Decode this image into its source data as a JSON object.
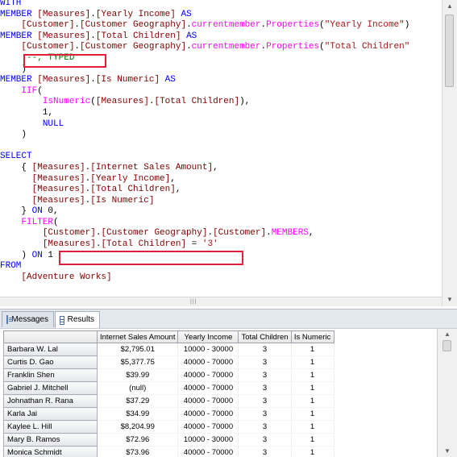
{
  "editor": {
    "lines": [
      [
        [
          "kw",
          "WITH"
        ]
      ],
      [
        [
          "kw",
          "MEMBER "
        ],
        [
          "mem",
          "[Measures]"
        ],
        [
          "",
          "."
        ],
        [
          "mem",
          "[Yearly Income]"
        ],
        [
          "kw",
          " AS"
        ]
      ],
      [
        [
          "",
          "    "
        ],
        [
          "mem",
          "[Customer]"
        ],
        [
          "",
          "."
        ],
        [
          "mem",
          "[Customer Geography]"
        ],
        [
          "",
          "."
        ],
        [
          "fn",
          "currentmember"
        ],
        [
          "",
          "."
        ],
        [
          "fn",
          "Properties"
        ],
        [
          "",
          "("
        ],
        [
          "str",
          "\"Yearly Income\""
        ],
        [
          "",
          ")"
        ]
      ],
      [
        [
          "kw",
          "MEMBER "
        ],
        [
          "mem",
          "[Measures]"
        ],
        [
          "",
          "."
        ],
        [
          "mem",
          "[Total Children]"
        ],
        [
          "kw",
          " AS"
        ]
      ],
      [
        [
          "",
          "    "
        ],
        [
          "mem",
          "[Customer]"
        ],
        [
          "",
          "."
        ],
        [
          "mem",
          "[Customer Geography]"
        ],
        [
          "",
          "."
        ],
        [
          "fn",
          "currentmember"
        ],
        [
          "",
          "."
        ],
        [
          "fn",
          "Properties"
        ],
        [
          "",
          "("
        ],
        [
          "str",
          "\"Total Children\""
        ]
      ],
      [
        [
          "",
          "     "
        ],
        [
          "cm",
          "--, TYPED"
        ]
      ],
      [
        [
          "",
          "    )"
        ]
      ],
      [
        [
          "kw",
          "MEMBER "
        ],
        [
          "mem",
          "[Measures]"
        ],
        [
          "",
          "."
        ],
        [
          "mem",
          "[Is Numeric]"
        ],
        [
          "kw",
          " AS"
        ]
      ],
      [
        [
          "",
          "    "
        ],
        [
          "fn",
          "IIF"
        ],
        [
          "",
          "("
        ]
      ],
      [
        [
          "",
          "        "
        ],
        [
          "fn",
          "IsNumeric"
        ],
        [
          "",
          "("
        ],
        [
          "mem",
          "[Measures]"
        ],
        [
          "",
          "."
        ],
        [
          "mem",
          "[Total Children]"
        ],
        [
          "",
          "),"
        ]
      ],
      [
        [
          "",
          "        1,"
        ]
      ],
      [
        [
          "",
          "        "
        ],
        [
          "kw",
          "NULL"
        ]
      ],
      [
        [
          "",
          "    )"
        ]
      ],
      [
        [
          "",
          ""
        ]
      ],
      [
        [
          "kw",
          "SELECT"
        ]
      ],
      [
        [
          "",
          "    { "
        ],
        [
          "mem",
          "[Measures]"
        ],
        [
          "",
          "."
        ],
        [
          "mem",
          "[Internet Sales Amount]"
        ],
        [
          "",
          ","
        ]
      ],
      [
        [
          "",
          "      "
        ],
        [
          "mem",
          "[Measures]"
        ],
        [
          "",
          "."
        ],
        [
          "mem",
          "[Yearly Income]"
        ],
        [
          "",
          ","
        ]
      ],
      [
        [
          "",
          "      "
        ],
        [
          "mem",
          "[Measures]"
        ],
        [
          "",
          "."
        ],
        [
          "mem",
          "[Total Children]"
        ],
        [
          "",
          ","
        ]
      ],
      [
        [
          "",
          "      "
        ],
        [
          "mem",
          "[Measures]"
        ],
        [
          "",
          "."
        ],
        [
          "mem",
          "[Is Numeric]"
        ]
      ],
      [
        [
          "",
          "    } "
        ],
        [
          "kw",
          "ON"
        ],
        [
          "",
          " 0,"
        ]
      ],
      [
        [
          "",
          "    "
        ],
        [
          "fn",
          "FILTER"
        ],
        [
          "",
          "("
        ]
      ],
      [
        [
          "",
          "        "
        ],
        [
          "mem",
          "[Customer]"
        ],
        [
          "",
          "."
        ],
        [
          "mem",
          "[Customer Geography]"
        ],
        [
          "",
          "."
        ],
        [
          "mem",
          "[Customer]"
        ],
        [
          "",
          "."
        ],
        [
          "fn",
          "MEMBERS"
        ],
        [
          "",
          ","
        ]
      ],
      [
        [
          "",
          "        "
        ],
        [
          "mem",
          "[Measures]"
        ],
        [
          "",
          "."
        ],
        [
          "mem",
          "[Total Children]"
        ],
        [
          "",
          " = "
        ],
        [
          "str",
          "'3'"
        ]
      ],
      [
        [
          "",
          "    ) "
        ],
        [
          "kw",
          "ON"
        ],
        [
          "",
          " 1"
        ]
      ],
      [
        [
          "kw",
          "FROM"
        ]
      ],
      [
        [
          "",
          "    "
        ],
        [
          "mem",
          "[Adventure Works]"
        ]
      ]
    ]
  },
  "tabs": {
    "messages_label": "Messages",
    "results_label": "Results"
  },
  "results": {
    "columns": [
      "Internet Sales Amount",
      "Yearly Income",
      "Total Children",
      "Is Numeric"
    ],
    "rows": [
      {
        "name": "Barbara W. Lal",
        "values": [
          "$2,795.01",
          "10000 - 30000",
          "3",
          "1"
        ]
      },
      {
        "name": "Curtis D. Gao",
        "values": [
          "$5,377.75",
          "40000 - 70000",
          "3",
          "1"
        ]
      },
      {
        "name": "Franklin Shen",
        "values": [
          "$39.99",
          "40000 - 70000",
          "3",
          "1"
        ]
      },
      {
        "name": "Gabriel J. Mitchell",
        "values": [
          "(null)",
          "40000 - 70000",
          "3",
          "1"
        ]
      },
      {
        "name": "Johnathan R. Rana",
        "values": [
          "$37.29",
          "40000 - 70000",
          "3",
          "1"
        ]
      },
      {
        "name": "Karla Jai",
        "values": [
          "$34.99",
          "40000 - 70000",
          "3",
          "1"
        ]
      },
      {
        "name": "Kaylee L. Hill",
        "values": [
          "$8,204.99",
          "40000 - 70000",
          "3",
          "1"
        ]
      },
      {
        "name": "Mary B. Ramos",
        "values": [
          "$72.96",
          "10000 - 30000",
          "3",
          "1"
        ]
      },
      {
        "name": "Monica Schmidt",
        "values": [
          "$73.96",
          "40000 - 70000",
          "3",
          "1"
        ]
      }
    ]
  },
  "colors": {
    "keyword": "#0000ff",
    "function": "#ff00ff",
    "member": "#800000",
    "string": "#a31515",
    "comment": "#008000",
    "highlight_box": "#e0203a"
  }
}
